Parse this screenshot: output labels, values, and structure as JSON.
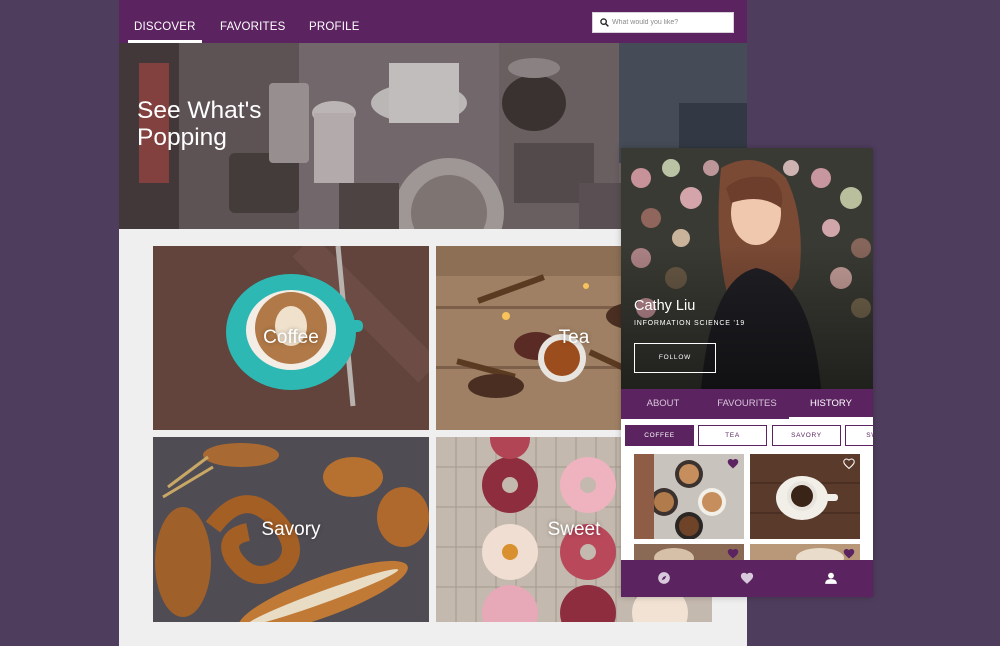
{
  "desktop": {
    "nav": {
      "tabs": [
        {
          "label": "DISCOVER",
          "active": true
        },
        {
          "label": "FAVORITES",
          "active": false
        },
        {
          "label": "PROFILE",
          "active": false
        }
      ],
      "search_placeholder": "What would you like?"
    },
    "hero": {
      "title": "See What's Popping"
    },
    "categories": [
      {
        "label": "Coffee"
      },
      {
        "label": "Tea"
      },
      {
        "label": "Savory"
      },
      {
        "label": "Sweet"
      }
    ]
  },
  "profile": {
    "name": "Cathy Liu",
    "department": "INFORMATION SCIENCE '19",
    "follow_label": "FOLLOW",
    "tabs": [
      {
        "label": "ABOUT",
        "active": false
      },
      {
        "label": "FAVOURITES",
        "active": false
      },
      {
        "label": "HISTORY",
        "active": true
      }
    ],
    "filters": [
      {
        "label": "COFFEE",
        "active": true
      },
      {
        "label": "TEA",
        "active": false
      },
      {
        "label": "SAVORY",
        "active": false
      },
      {
        "label": "SWEET",
        "active": false
      }
    ],
    "history_items": [
      {
        "favorited": true
      },
      {
        "favorited": false
      },
      {
        "favorited": true
      },
      {
        "favorited": true
      }
    ],
    "bottom_nav": [
      "compass-icon",
      "heart-icon",
      "user-icon"
    ]
  },
  "colors": {
    "brand_purple": "#5b2360",
    "background": "#4f3d5e",
    "content_bg": "#efefef"
  }
}
